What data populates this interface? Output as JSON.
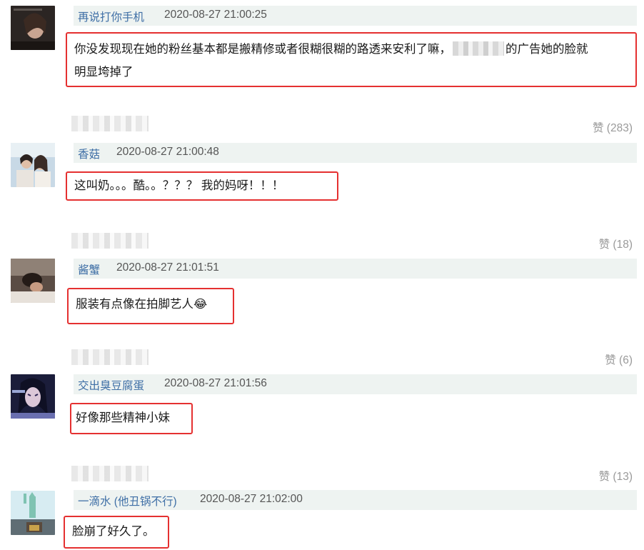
{
  "comments": [
    {
      "username": "再说打你手机",
      "time": "2020-08-27 21:00:25",
      "text_line1": "你没发现现在她的粉丝基本都是搬精修或者很糊很糊的路透来安利了嘛，",
      "text_line1b": "的广告她的脸就",
      "text_line2": "明显垮掉了",
      "likes": "赞 (283)"
    },
    {
      "username": "香菇",
      "time": "2020-08-27 21:00:48",
      "text": "这叫奶。。。酷。。？？？ 我的妈呀！！！",
      "likes": "赞 (18)"
    },
    {
      "username": "酱蟹",
      "time": "2020-08-27 21:01:51",
      "text": "服装有点像在拍脚艺人",
      "emoji": "😂",
      "likes": "赞 (6)"
    },
    {
      "username": "交出臭豆腐蛋",
      "time": "2020-08-27 21:01:56",
      "text": "好像那些精神小妹",
      "likes": "赞 (13)"
    },
    {
      "username": "一滴水 (他丑锅不行)",
      "time": "2020-08-27 21:02:00",
      "text": "脸崩了好久了。"
    }
  ],
  "colors": {
    "highlight_border": "#e53030",
    "username": "#3f6fa6",
    "meta_bg": "#eef3f1"
  }
}
